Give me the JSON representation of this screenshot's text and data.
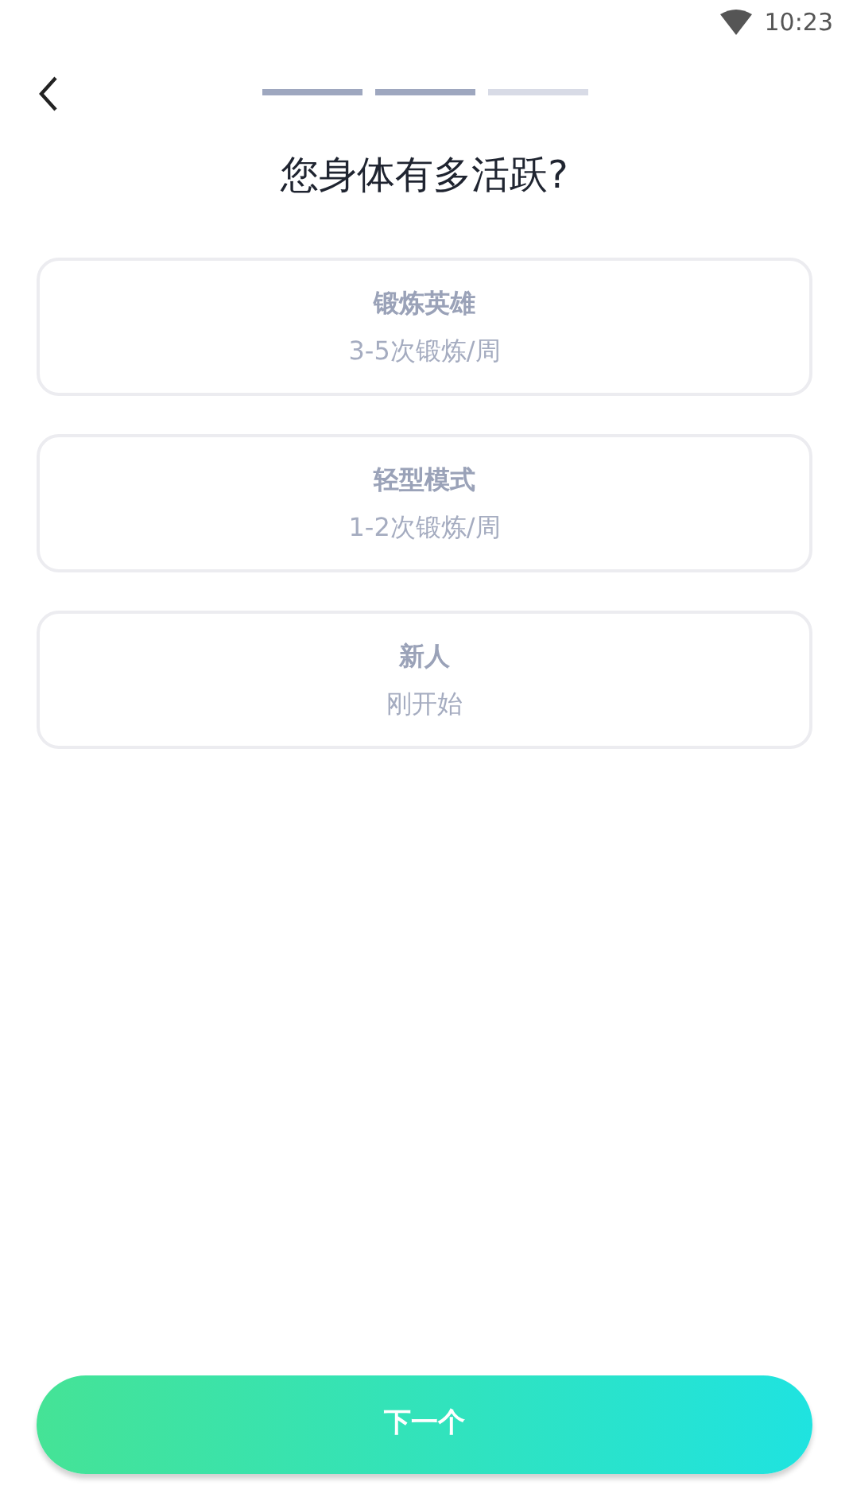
{
  "status_bar": {
    "time": "10:23"
  },
  "progress_steps": [
    {
      "done": true
    },
    {
      "done": true
    },
    {
      "done": false
    }
  ],
  "title": "您身体有多活跃?",
  "options": [
    {
      "label": "锻炼英雄",
      "detail": "3-5次锻炼/周",
      "selected": false
    },
    {
      "label": "轻型模式",
      "detail": "1-2次锻炼/周",
      "selected": false
    },
    {
      "label": "新人",
      "detail": "刚开始",
      "selected": false
    }
  ],
  "next_button": {
    "label": "下一个"
  }
}
